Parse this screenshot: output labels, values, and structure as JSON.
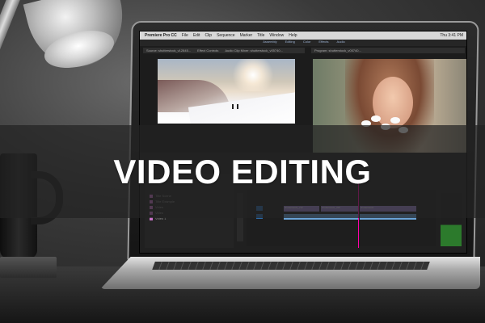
{
  "banner": {
    "title": "VIDEO EDITING"
  },
  "app_screen": {
    "menubar": {
      "app_name": "Premiere Pro CC",
      "items": [
        "File",
        "Edit",
        "Clip",
        "Sequence",
        "Marker",
        "Title",
        "Window",
        "Help"
      ],
      "clock": "Thu 3:41 PM"
    },
    "workspace_tabs": [
      "Assembly",
      "Editing",
      "Color",
      "Effects",
      "Audio"
    ],
    "source_panel_tabs": [
      "Source: shutterstock_v12845...",
      "Effect Controls",
      "Audio Clip Mixer: shutterstock_v05740...",
      "Metadata"
    ],
    "program_panel_tab": "Program: shutterstock_v05740...",
    "project_items": [
      "Title Scene",
      "Title Example",
      "Video",
      "Video",
      "Video 1"
    ],
    "clip_labels": [
      "shutterstock_v12",
      "shutterstock_v05",
      "shutterstock"
    ]
  },
  "colors": {
    "banner_bg": "#232323",
    "banner_text": "#ffffff",
    "video_clip": "#9d87d1",
    "audio_clip": "#6aa3d8"
  }
}
